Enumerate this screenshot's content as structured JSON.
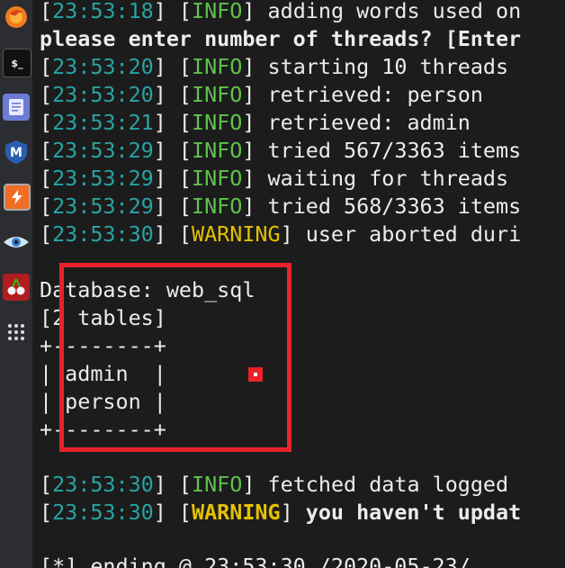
{
  "dock": {
    "items": [
      {
        "icon": "firefox-icon",
        "color": "#e66000"
      },
      {
        "icon": "terminal-icon",
        "color": "#222222",
        "text": "$_"
      },
      {
        "icon": "text-editor-icon",
        "color": "#6c7bd6"
      },
      {
        "icon": "metasploit-icon",
        "color": "#2a5db0",
        "text": "M"
      },
      {
        "icon": "burpsuite-icon",
        "color": "#f06d24",
        "text": "⚡"
      },
      {
        "icon": "eye-icon",
        "color": "#4a8ed8"
      },
      {
        "icon": "cherrytree-icon",
        "color": "#b01e22"
      },
      {
        "icon": "app-grid-icon",
        "color": "#2b2d30"
      }
    ]
  },
  "terminal": {
    "lines": [
      {
        "time": "23:53:18",
        "level": "INFO",
        "msg": " adding words used on"
      },
      {
        "text": "please enter number of threads? [Enter"
      },
      {
        "time": "23:53:20",
        "level": "INFO",
        "msg": " starting 10 threads"
      },
      {
        "time": "23:53:20",
        "level": "INFO",
        "msg": " retrieved: person"
      },
      {
        "time": "23:53:21",
        "level": "INFO",
        "msg": " retrieved: admin"
      },
      {
        "time": "23:53:29",
        "level": "INFO",
        "msg": " tried 567/3363 items"
      },
      {
        "time": "23:53:29",
        "level": "INFO",
        "msg": " waiting for threads"
      },
      {
        "time": "23:53:29",
        "level": "INFO",
        "msg": " tried 568/3363 items"
      },
      {
        "time": "23:53:30",
        "level": "WARNING",
        "msg": " user aborted duri"
      },
      {
        "text": "Database: web_sql"
      },
      {
        "text": "[2 tables]"
      },
      {
        "text": "+--------+"
      },
      {
        "text": "| admin  |"
      },
      {
        "text": "| person |"
      },
      {
        "text": "+--------+"
      },
      {
        "time": "23:53:30",
        "level": "INFO",
        "msg": " fetched data logged"
      },
      {
        "time": "23:53:30",
        "level": "WARNING",
        "msg": " you haven't updat"
      },
      {
        "text": "[*] ending @ 23:53:30 /2020-05-23/"
      }
    ]
  },
  "colors": {
    "timestamp": "#29a3a3",
    "info": "#5fc24a",
    "warning": "#e5c100",
    "highlight": "#e8232b"
  }
}
